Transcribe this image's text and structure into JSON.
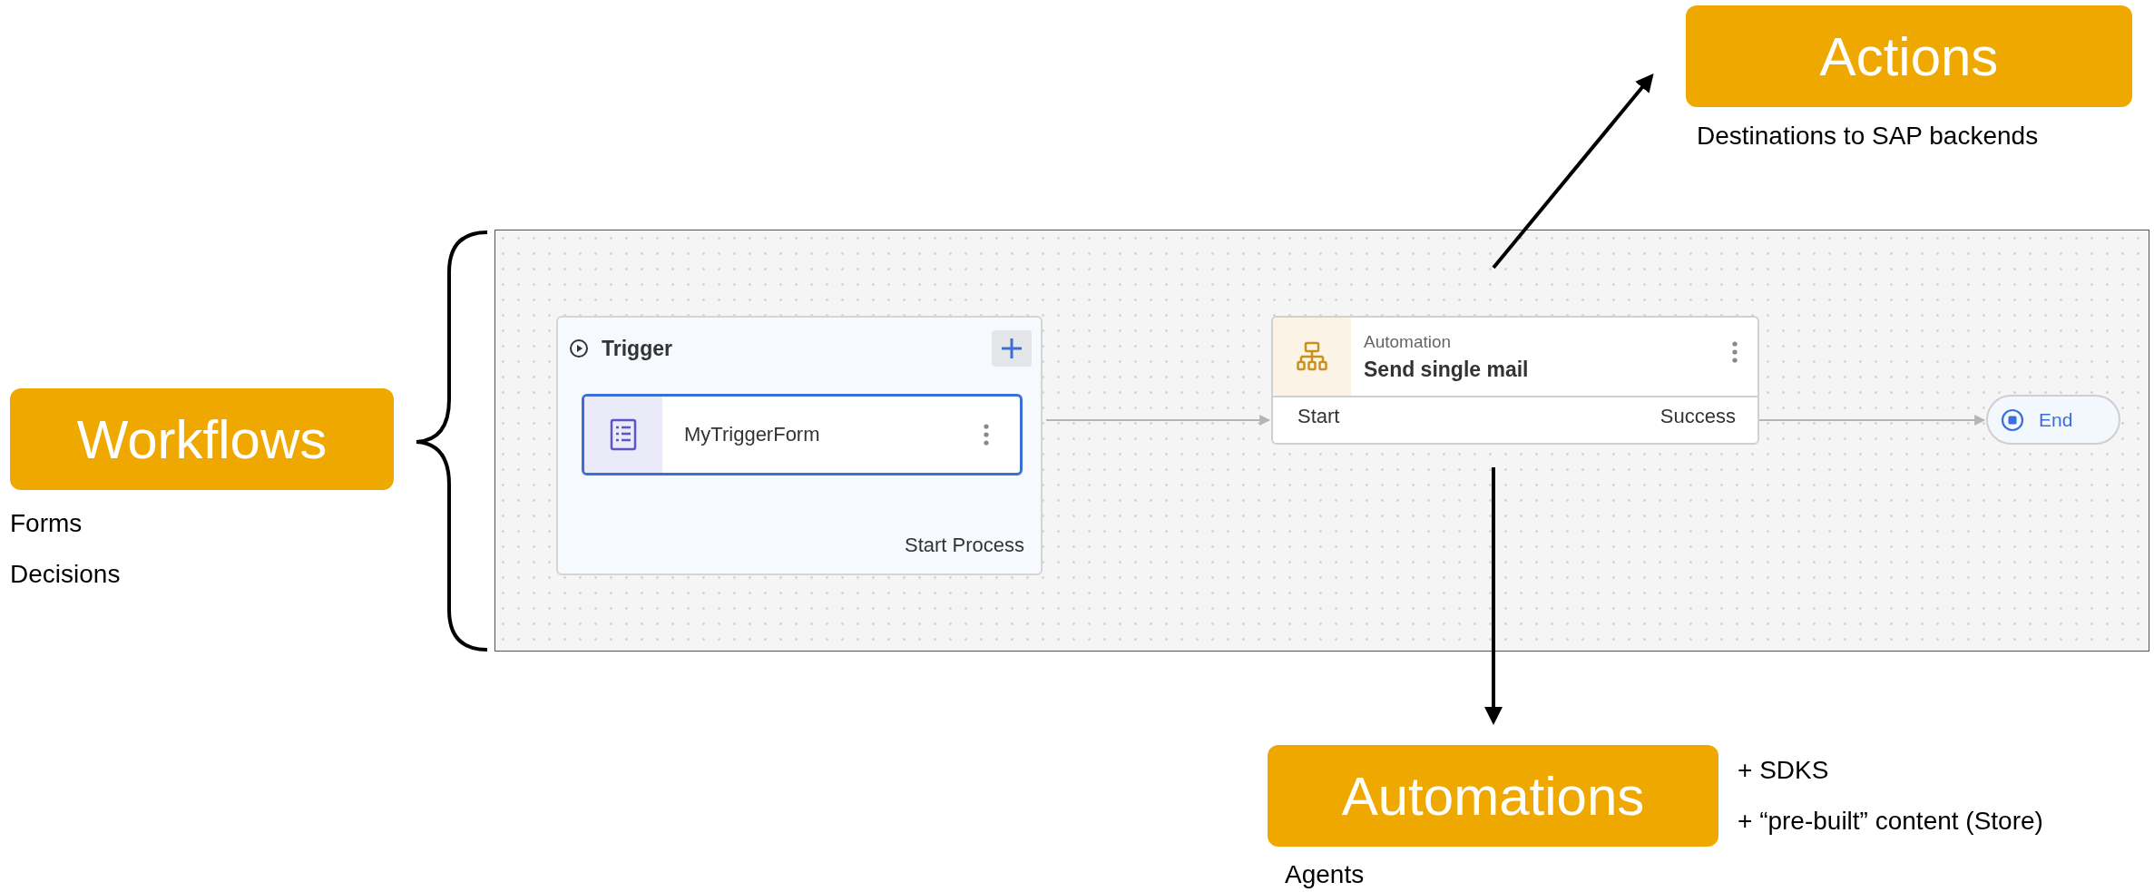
{
  "callouts": [
    {
      "kind": "workflows",
      "title": "Workflows",
      "notes": [
        "Forms",
        "Decisions"
      ]
    },
    {
      "kind": "actions",
      "title": "Actions",
      "notes": [
        "Destinations to SAP backends"
      ]
    },
    {
      "kind": "automations",
      "title": "Automations",
      "notes": [
        "+ SDKS",
        "+ “pre-built” content (Store)",
        "Agents"
      ]
    }
  ],
  "canvas": {
    "trigger": {
      "title": "Trigger",
      "form": {
        "name": "MyTriggerForm",
        "selected": true
      },
      "footer": "Start Process"
    },
    "automation": {
      "type": "Automation",
      "name": "Send single mail",
      "ports": [
        "Start",
        "Success"
      ]
    },
    "end": {
      "label": "End"
    }
  }
}
